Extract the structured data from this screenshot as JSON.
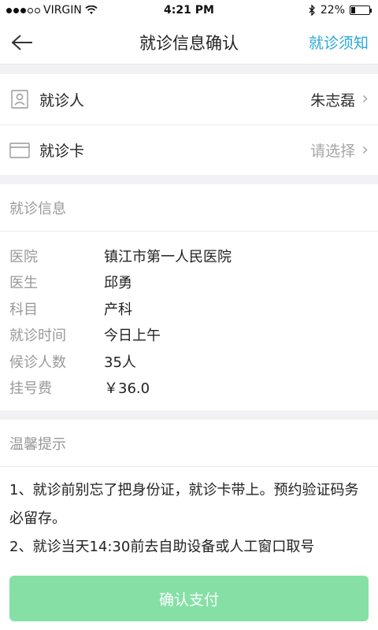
{
  "status_bar": {
    "carrier": "VIRGIN",
    "time": "4:21 PM",
    "battery": "22%",
    "battery_level": 0.22
  },
  "nav": {
    "title": "就诊信息确认",
    "right_link": "就诊须知"
  },
  "patient": {
    "label": "就诊人",
    "value": "朱志磊"
  },
  "card": {
    "label": "就诊卡",
    "value": "请选择"
  },
  "visit_info": {
    "header": "就诊信息",
    "rows": [
      {
        "key": "医院",
        "value": "镇江市第一人民医院"
      },
      {
        "key": "医生",
        "value": "邱勇"
      },
      {
        "key": "科目",
        "value": "产科"
      },
      {
        "key": "就诊时间",
        "value": "今日上午"
      },
      {
        "key": "候诊人数",
        "value": "35人"
      },
      {
        "key": "挂号费",
        "value": "￥36.0"
      }
    ]
  },
  "tips": {
    "header": "温馨提示",
    "line1": "1、就诊前别忘了把身份证，就诊卡带上。预约验证码务必留存。",
    "line2": "2、就诊当天14:30前去自助设备或人工窗口取号"
  },
  "footer": {
    "pay_button": "确认支付"
  },
  "colors": {
    "accent": "#29a8d8",
    "button": "#86e0a6"
  }
}
